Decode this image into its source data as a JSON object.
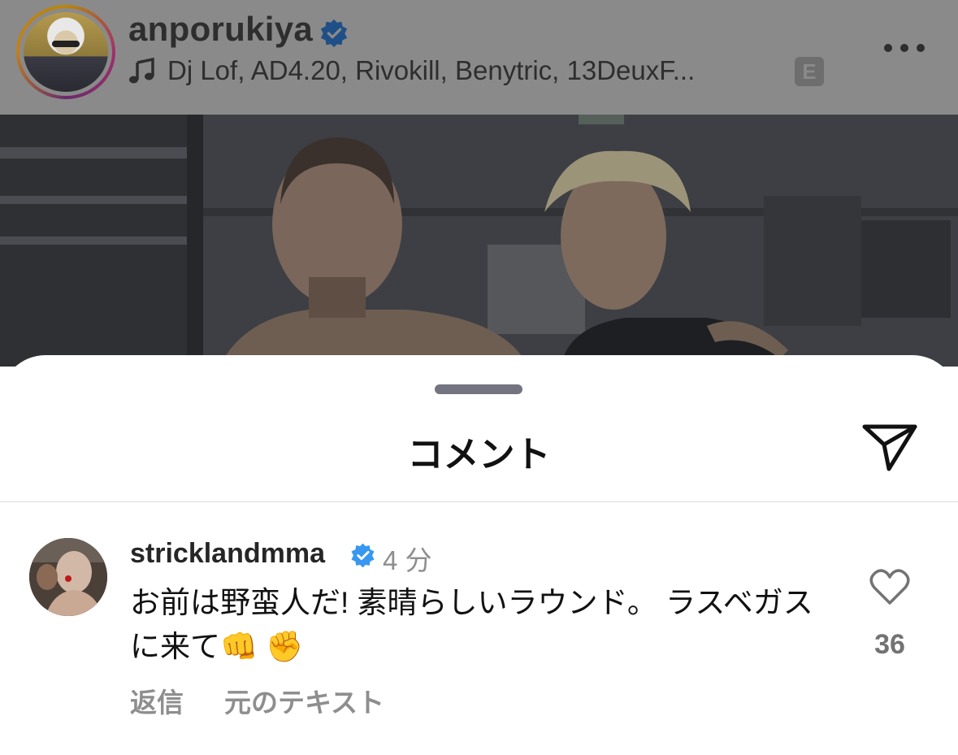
{
  "post": {
    "username": "anporukiya",
    "music": "Dj Lof, AD4.20, Rivokill, Benytric, 13DeuxF...",
    "explicit_badge": "E",
    "icons": {
      "verified": "verified-badge-icon",
      "music": "music-note-icon",
      "more": "more-options-icon"
    }
  },
  "sheet": {
    "title": "コメント",
    "icons": {
      "share": "send-icon"
    }
  },
  "comment": {
    "username": "stricklandmma",
    "time": "4 分",
    "text": "お前は野蛮人だ! 素晴らしいラウンド。 ラスベガスに来て👊 ✊",
    "like_count": "36",
    "reply_label": "返信",
    "original_text_label": "元のテキスト"
  },
  "colors": {
    "verified_blue": "#3897f0",
    "overlay_gray": "#8a8a8a",
    "secondary_text": "#8e8e8e"
  }
}
